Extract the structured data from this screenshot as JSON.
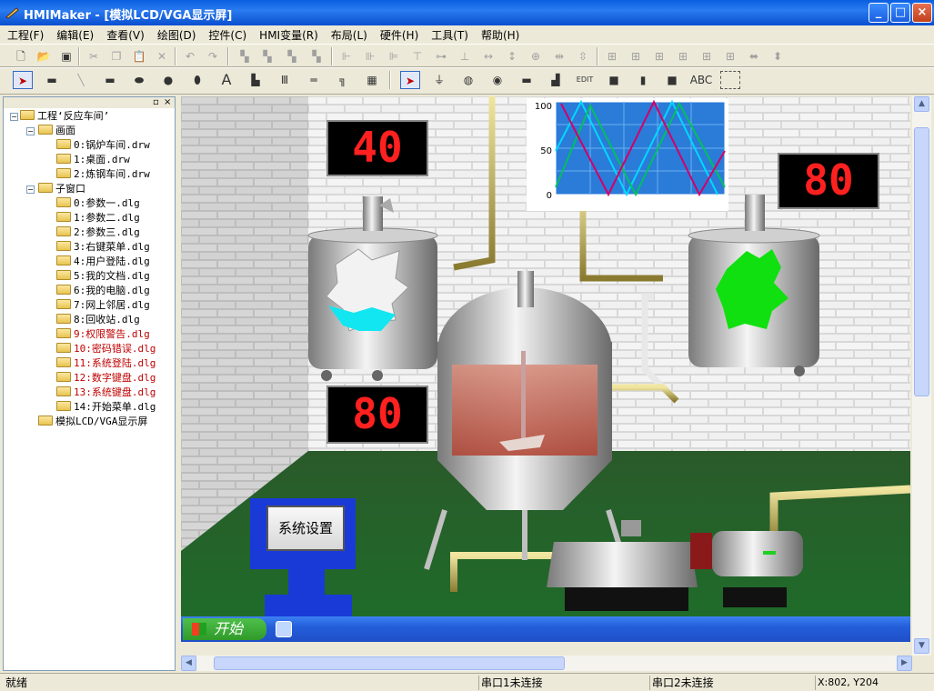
{
  "window": {
    "title": "HMIMaker - [模拟LCD/VGA显示屏]",
    "min_label": "_",
    "max_label": "□",
    "close_label": "×"
  },
  "menu": [
    "工程(F)",
    "编辑(E)",
    "查看(V)",
    "绘图(D)",
    "控件(C)",
    "HMI变量(R)",
    "布局(L)",
    "硬件(H)",
    "工具(T)",
    "帮助(H)"
  ],
  "tree": {
    "header_pin": "▫",
    "header_close": "×",
    "root": "工程‘反应车间’",
    "screens_label": "画面",
    "screens": [
      "0:锅炉车间.drw",
      "1:桌面.drw",
      "2:炼钢车间.drw"
    ],
    "subwin_label": "子窗口",
    "subwindows": [
      {
        "label": "0:参数一.dlg",
        "red": false
      },
      {
        "label": "1:参数二.dlg",
        "red": false
      },
      {
        "label": "2:参数三.dlg",
        "red": false
      },
      {
        "label": "3:右键菜单.dlg",
        "red": false
      },
      {
        "label": "4:用户登陆.dlg",
        "red": false
      },
      {
        "label": "5:我的文档.dlg",
        "red": false
      },
      {
        "label": "6:我的电脑.dlg",
        "red": false
      },
      {
        "label": "7:网上邻居.dlg",
        "red": false
      },
      {
        "label": "8:回收站.dlg",
        "red": false
      },
      {
        "label": "9:权限警告.dlg",
        "red": true
      },
      {
        "label": "10:密码错误.dlg",
        "red": true
      },
      {
        "label": "11:系统登陆.dlg",
        "red": true
      },
      {
        "label": "12:数字键盘.dlg",
        "red": true
      },
      {
        "label": "13:系统键盘.dlg",
        "red": true
      },
      {
        "label": "14:开始菜单.dlg",
        "red": false
      }
    ],
    "lcd_label": "模拟LCD/VGA显示屏"
  },
  "scene": {
    "led_top_left": "40",
    "led_top_right": "80",
    "led_bottom_left": "80",
    "trend_ticks": [
      "100",
      "50",
      "0"
    ],
    "trend_trace_colors": [
      "#00d8ff",
      "#00c060",
      "#d0006a"
    ],
    "system_button": "系统设置",
    "start_button": "开始"
  },
  "toolbar2_text": "ABC",
  "status": {
    "ready": "就绪",
    "port1": "串口1未连接",
    "port2": "串口2未连接",
    "coords": "X:802, Y204"
  }
}
